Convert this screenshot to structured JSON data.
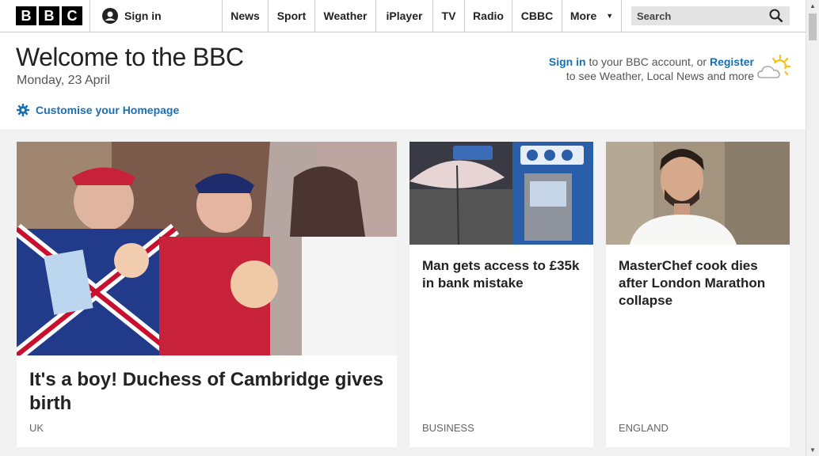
{
  "header": {
    "logo": [
      "B",
      "B",
      "C"
    ],
    "sign_in": "Sign in",
    "nav": [
      "News",
      "Sport",
      "Weather",
      "iPlayer",
      "TV",
      "Radio",
      "CBBC",
      "More"
    ],
    "search_placeholder": "Search"
  },
  "welcome": {
    "title": "Welcome to the BBC",
    "date": "Monday, 23 April",
    "customise": "Customise your Homepage",
    "account_signin": "Sign in",
    "account_mid": "to your BBC account, or",
    "account_register": "Register",
    "account_tail": "to see Weather, Local News and more"
  },
  "stories": [
    {
      "headline": "It's a boy! Duchess of Cambridge gives birth",
      "section": "UK"
    },
    {
      "headline": "Man gets access to £35k in bank mistake",
      "section": "BUSINESS"
    },
    {
      "headline": "MasterChef cook dies after London Marathon collapse",
      "section": "ENGLAND"
    }
  ],
  "colors": {
    "link": "#1a6fb5",
    "bg": "#f2f2f2"
  }
}
